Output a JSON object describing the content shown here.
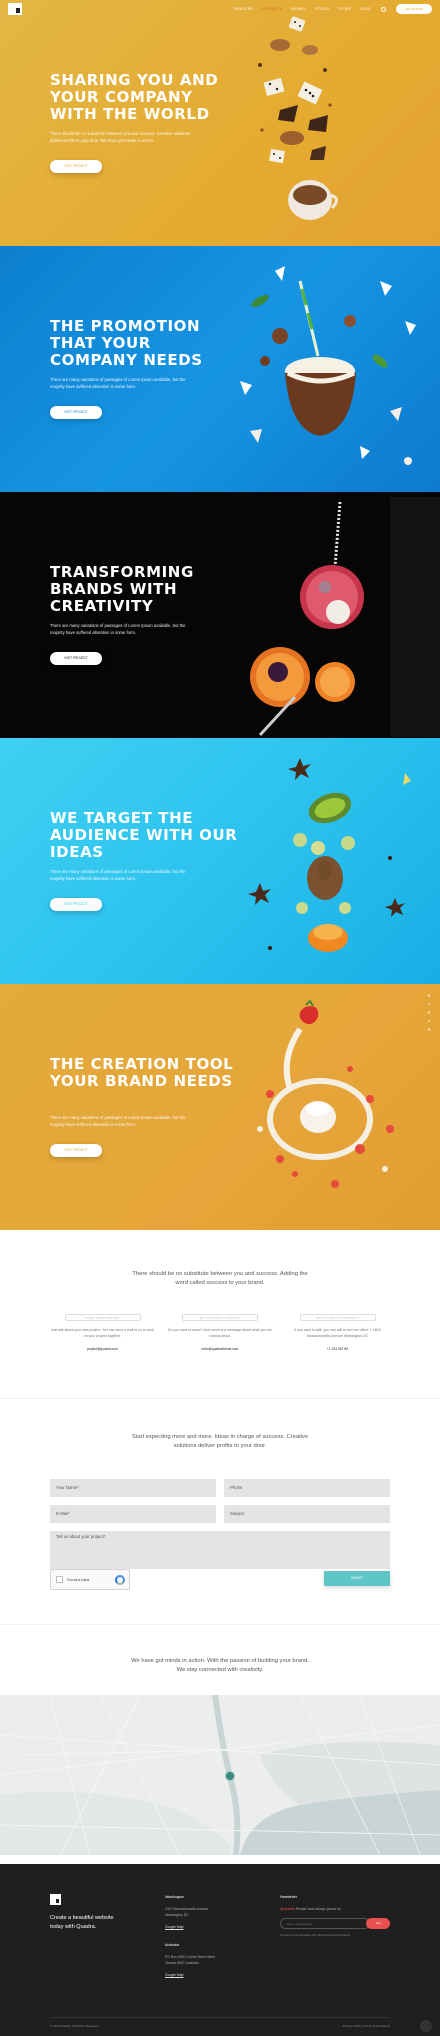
{
  "header": {
    "nav": [
      "Services",
      "Projects",
      "Works",
      "Studio",
      "Store",
      "Blog"
    ],
    "active_index": 1,
    "cta": "Get Quote"
  },
  "slides": [
    {
      "title": "Sharing you and your company with the world",
      "text": "There should be no substitute between you and success. Creative solutions deliver profits to your door. We have got minds in action.",
      "button": "Visit Project",
      "button_color": "#e6a234"
    },
    {
      "title": "The promotion that your company needs",
      "text": "There are many variations of passages of Lorem Ipsum available, but the majority have suffered alteration in some form.",
      "button": "Visit Project",
      "button_color": "#1480d3"
    },
    {
      "title": "Transforming brands with creativity",
      "text": "There are many variations of passages of Lorem Ipsum available, but the majority have suffered alteration in some form.",
      "button": "Visit Project",
      "button_color": "#111111"
    },
    {
      "title": "We target the audience with our ideas",
      "text": "There are many variations of passages of Lorem Ipsum available, but the majority have suffered alteration in some form.",
      "button": "Visit Project",
      "button_color": "#2ec4ef"
    },
    {
      "title": "The creation tool your brand needs",
      "text": "There are many variations of passages of Lorem Ipsum available, but the majority have suffered alteration in some form.",
      "button": "Visit Project",
      "button_color": "#e4a436"
    }
  ],
  "intro": {
    "lead": "There should be no substitute between you and success. Adding the word called success to your brand.",
    "cards": [
      {
        "tag": "Start a new project",
        "text": "Just talk about your new project. You can send a mail to us to work on your project together.",
        "link": "project@quadra.com"
      },
      {
        "tag": "Do you want to join us?",
        "text": "Do you want to leave? Just send us a message about what you are curious about.",
        "link": "hello@quadratheme.com"
      },
      {
        "tag": "Do you want to contact?",
        "text": "If you want to talk, you can call or text our office. + 1815 Massachusetts Avenue Washington DC",
        "link": "+1 234 567 89"
      }
    ]
  },
  "contact": {
    "lead": "Start expecting more and more. Ideas in charge of success. Creative solutions deliver profits to your door.",
    "fields": {
      "name": "Your Name*",
      "phone": "Phone",
      "email": "E-Mail*",
      "subject": "Subject",
      "message": "Tell us about your project*"
    },
    "captcha": "I'm not a robot",
    "submit": "Submit"
  },
  "map": {
    "lead": "We have got minds in action. With the passion of building your brand. We stay connected with creativity."
  },
  "footer": {
    "tagline": "Create a beautiful website today with Quadra.",
    "col1": {
      "heading": "Washington",
      "lines": [
        "2412 Massachusetts Avenue",
        "Washington DC"
      ],
      "link": "Google Map"
    },
    "col2": {
      "heading": "Australia",
      "lines": [
        "PO Box 1600 Collins Street West",
        "Victoria 8007 Australia"
      ],
      "link": "Google Map"
    },
    "newsletter": {
      "heading": "Newsletter",
      "highlight": "@Quadra",
      "text": "People have always joined us.",
      "placeholder": "Your e-mail address",
      "button": "Join",
      "note": "You can get our newsletter with subscriptions and campaigns."
    },
    "copyright": "© 2024 Quadra. All Rights Reserved.",
    "legal": "Privacy Policy | Terms & Conditions"
  }
}
